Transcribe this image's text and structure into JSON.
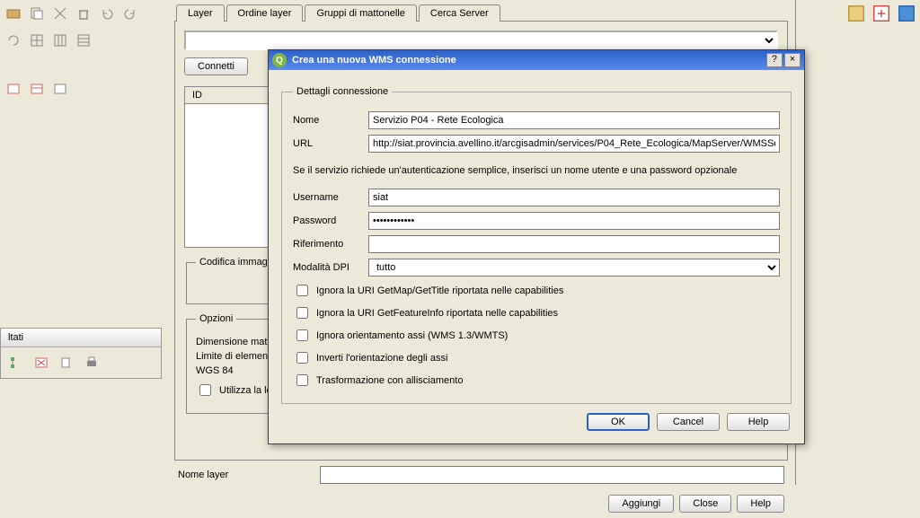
{
  "left_results_header": "ltati",
  "main": {
    "tabs": [
      "Layer",
      "Ordine layer",
      "Gruppi di mattonelle",
      "Cerca Server"
    ],
    "active_tab_index": 0,
    "connetti_label": "Connetti",
    "list_header": "ID",
    "codifica_legend": "Codifica immagine",
    "opzioni": {
      "legend": "Opzioni",
      "dim_label": "Dimensione mattone",
      "limit_label": "Limite di elementi pe",
      "wgs": "WGS 84",
      "legenda_chk": "Utilizza la legen"
    },
    "nome_layer_label": "Nome layer",
    "bottom_buttons": {
      "aggiungi": "Aggiungi",
      "close": "Close",
      "help": "Help"
    }
  },
  "dialog": {
    "title_icon_text": "Q",
    "title": "Crea una nuova WMS connessione",
    "help_btn": "?",
    "close_btn": "×",
    "details_legend": "Dettagli connessione",
    "nome_label": "Nome",
    "nome_value": "Servizio P04 - Rete Ecologica",
    "url_label": "URL",
    "url_value": "http://siat.provincia.avellino.it/arcgisadmin/services/P04_Rete_Ecologica/MapServer/WMSServe",
    "info": "Se il servizio richiede un'autenticazione semplice, inserisci un nome utente e una password opzionale",
    "username_label": "Username",
    "username_value": "siat",
    "password_label": "Password",
    "password_value": "••••••••••••",
    "riferimento_label": "Riferimento",
    "riferimento_value": "",
    "dpi_label": "Modalità DPI",
    "dpi_value": "tutto",
    "chk1": "Ignora la URI GetMap/GetTitle riportata nelle capabilities",
    "chk2": "Ignora la URI GetFeatureInfo riportata nelle capabilities",
    "chk3": "Ignora orientamento assi (WMS 1.3/WMTS)",
    "chk4": "Inverti l'orientazione degli assi",
    "chk5": "Trasformazione con allisciamento",
    "ok": "OK",
    "cancel": "Cancel",
    "help": "Help"
  }
}
